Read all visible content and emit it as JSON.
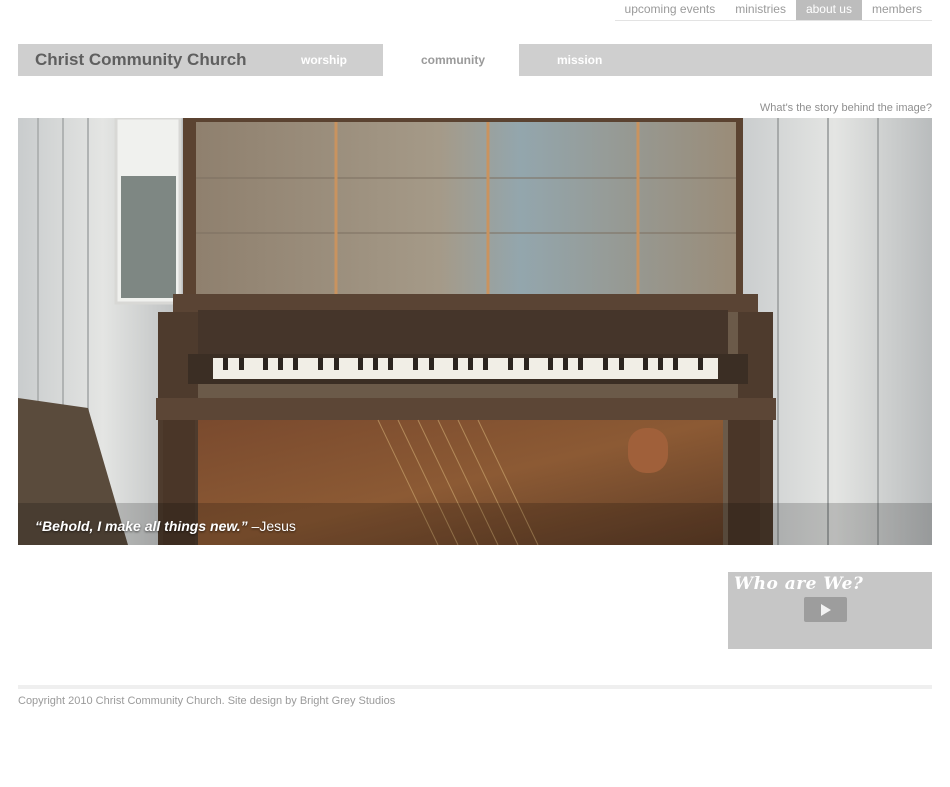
{
  "top_nav": {
    "items": [
      {
        "label": "upcoming events"
      },
      {
        "label": "ministries"
      },
      {
        "label": "about us",
        "active": true
      },
      {
        "label": "members"
      }
    ]
  },
  "header": {
    "site_title": "Christ Community Church",
    "nav": [
      "worship",
      "community",
      "mission"
    ]
  },
  "hero": {
    "story_link": "What's the story behind the image?",
    "quote": "“Behold, I make all things new.”",
    "attribution": "–Jesus"
  },
  "video": {
    "title": "Who are We?",
    "play_icon": "play-icon"
  },
  "footer": {
    "copyright": "Copyright 2010 Christ Community Church. Site design by Bright Grey Studios"
  },
  "colors": {
    "bar_gray": "#cfcfcf",
    "active_tab": "#bdbdbd",
    "text_gray": "#9a9a9a",
    "title_gray": "#5f5f5f"
  }
}
